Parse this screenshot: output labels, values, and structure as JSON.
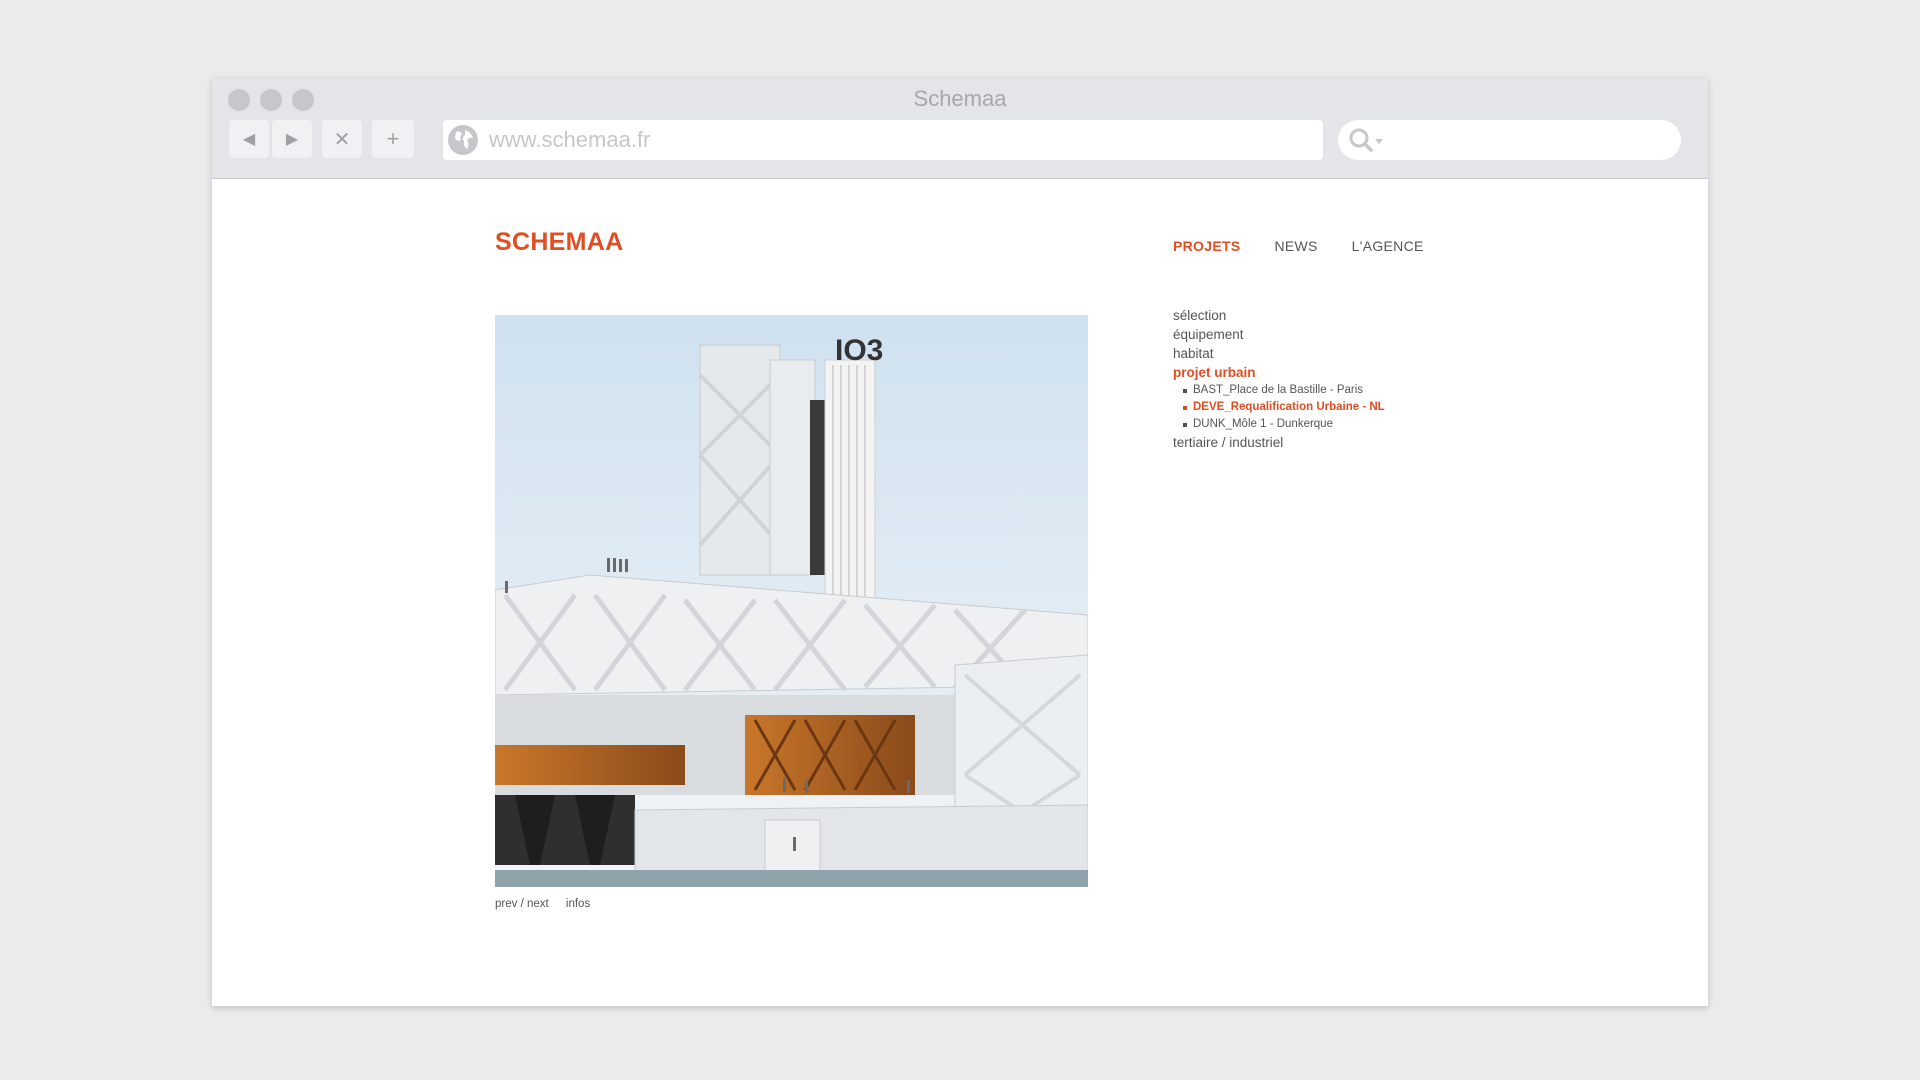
{
  "window": {
    "title": "Schemaa",
    "url": "www.schemaa.fr",
    "nav": {
      "back": "◀",
      "forward": "▶",
      "stop": "✕",
      "new_tab": "+"
    }
  },
  "site": {
    "logo": "SCHEMAA",
    "top_nav": [
      {
        "label": "PROJETS",
        "active": true
      },
      {
        "label": "NEWS",
        "active": false
      },
      {
        "label": "L'AGENCE",
        "active": false
      }
    ],
    "categories": [
      {
        "label": "sélection"
      },
      {
        "label": "équipement"
      },
      {
        "label": "habitat"
      },
      {
        "label": "projet urbain",
        "active": true
      },
      {
        "label": "tertiaire / industriel"
      }
    ],
    "projects": [
      {
        "label": "BAST_Place de la Bastille - Paris"
      },
      {
        "label": "DEVE_Requalification Urbaine - NL",
        "active": true
      },
      {
        "label": "DUNK_Môle 1 - Dunkerque"
      }
    ],
    "image_links": {
      "prev_next": "prev / next",
      "infos": "infos"
    },
    "accent_color": "#e04e24"
  }
}
